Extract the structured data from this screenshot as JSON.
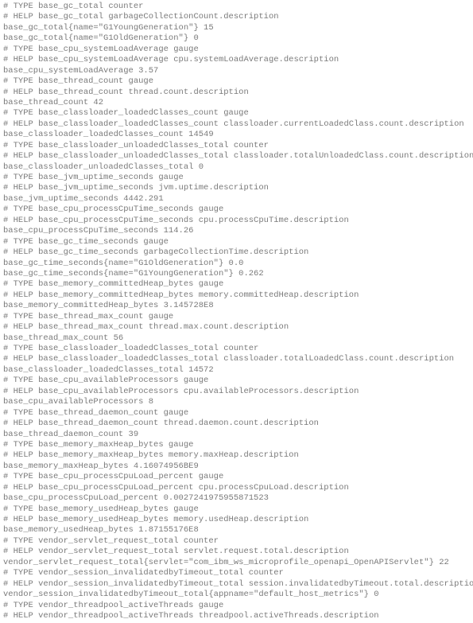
{
  "lines": [
    "# TYPE base_gc_total counter",
    "# HELP base_gc_total garbageCollectionCount.description",
    "base_gc_total{name=\"G1YoungGeneration\"} 15",
    "base_gc_total{name=\"G1OldGeneration\"} 0",
    "# TYPE base_cpu_systemLoadAverage gauge",
    "# HELP base_cpu_systemLoadAverage cpu.systemLoadAverage.description",
    "base_cpu_systemLoadAverage 3.57",
    "# TYPE base_thread_count gauge",
    "# HELP base_thread_count thread.count.description",
    "base_thread_count 42",
    "# TYPE base_classloader_loadedClasses_count gauge",
    "# HELP base_classloader_loadedClasses_count classloader.currentLoadedClass.count.description",
    "base_classloader_loadedClasses_count 14549",
    "# TYPE base_classloader_unloadedClasses_total counter",
    "# HELP base_classloader_unloadedClasses_total classloader.totalUnloadedClass.count.description",
    "base_classloader_unloadedClasses_total 0",
    "# TYPE base_jvm_uptime_seconds gauge",
    "# HELP base_jvm_uptime_seconds jvm.uptime.description",
    "base_jvm_uptime_seconds 4442.291",
    "# TYPE base_cpu_processCpuTime_seconds gauge",
    "# HELP base_cpu_processCpuTime_seconds cpu.processCpuTime.description",
    "base_cpu_processCpuTime_seconds 114.26",
    "# TYPE base_gc_time_seconds gauge",
    "# HELP base_gc_time_seconds garbageCollectionTime.description",
    "base_gc_time_seconds{name=\"G1OldGeneration\"} 0.0",
    "base_gc_time_seconds{name=\"G1YoungGeneration\"} 0.262",
    "# TYPE base_memory_committedHeap_bytes gauge",
    "# HELP base_memory_committedHeap_bytes memory.committedHeap.description",
    "base_memory_committedHeap_bytes 3.145728E8",
    "# TYPE base_thread_max_count gauge",
    "# HELP base_thread_max_count thread.max.count.description",
    "base_thread_max_count 56",
    "# TYPE base_classloader_loadedClasses_total counter",
    "# HELP base_classloader_loadedClasses_total classloader.totalLoadedClass.count.description",
    "base_classloader_loadedClasses_total 14572",
    "# TYPE base_cpu_availableProcessors gauge",
    "# HELP base_cpu_availableProcessors cpu.availableProcessors.description",
    "base_cpu_availableProcessors 8",
    "# TYPE base_thread_daemon_count gauge",
    "# HELP base_thread_daemon_count thread.daemon.count.description",
    "base_thread_daemon_count 39",
    "# TYPE base_memory_maxHeap_bytes gauge",
    "# HELP base_memory_maxHeap_bytes memory.maxHeap.description",
    "base_memory_maxHeap_bytes 4.16074956BE9",
    "# TYPE base_cpu_processCpuLoad_percent gauge",
    "# HELP base_cpu_processCpuLoad_percent cpu.processCpuLoad.description",
    "base_cpu_processCpuLoad_percent 0.0027241975955871523",
    "# TYPE base_memory_usedHeap_bytes gauge",
    "# HELP base_memory_usedHeap_bytes memory.usedHeap.description",
    "base_memory_usedHeap_bytes 1.87155176E8",
    "# TYPE vendor_servlet_request_total counter",
    "# HELP vendor_servlet_request_total servlet.request.total.description",
    "vendor_servlet_request_total{servlet=\"com_ibm_ws_microprofile_openapi_OpenAPIServlet\"} 22",
    "# TYPE vendor_session_invalidatedbyTimeout_total counter",
    "# HELP vendor_session_invalidatedbyTimeout_total session.invalidatedbyTimeout.total.description",
    "vendor_session_invalidatedbyTimeout_total{appname=\"default_host_metrics\"} 0",
    "# TYPE vendor_threadpool_activeThreads gauge",
    "# HELP vendor_threadpool_activeThreads threadpool.activeThreads.description"
  ]
}
